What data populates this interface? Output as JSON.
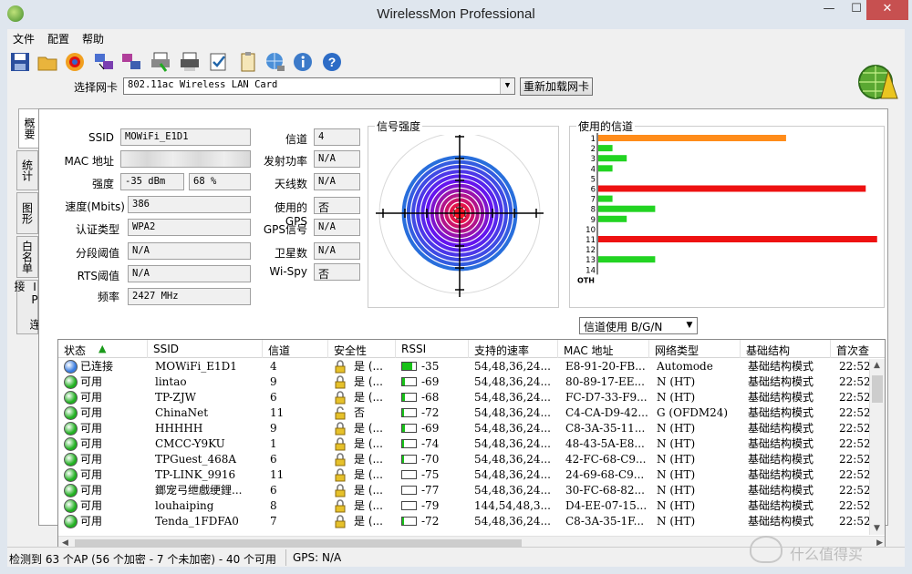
{
  "window": {
    "title": "WirelessMon Professional",
    "minimize": "—",
    "maximize": "☐",
    "close": "✕"
  },
  "menu": [
    "文件",
    "配置",
    "帮助"
  ],
  "toolbar": [
    "save-icon",
    "open-folder-icon",
    "record-icon",
    "network-monitor-icon",
    "network-compare-icon",
    "print-icon",
    "print-preview-icon",
    "check-list-icon",
    "clipboard-icon",
    "globe-connect-icon",
    "info-icon",
    "help-icon"
  ],
  "adapter": {
    "label": "选择网卡",
    "value": "802.11ac Wireless LAN Card",
    "reload": "重新加载网卡"
  },
  "tabs": [
    "概要",
    "统计",
    "图形",
    "白名单",
    "IP 连接"
  ],
  "summary": {
    "ssid_label": "SSID",
    "ssid": "MOWiFi_E1D1",
    "mac_label": "MAC 地址",
    "mac": "",
    "strength_label": "强度",
    "strength_dbm": "-35 dBm",
    "strength_pct": "68 %",
    "speed_label": "速度(Mbits)",
    "speed": "386",
    "auth_label": "认证类型",
    "auth": "WPA2",
    "frag_label": "分段阈值",
    "frag": "N/A",
    "rts_label": "RTS阈值",
    "rts": "N/A",
    "freq_label": "频率",
    "freq": "2427 MHz",
    "channel_label": "信道",
    "channel": "4",
    "txpower_label": "发射功率",
    "txpower": "N/A",
    "antenna_label": "天线数",
    "antenna": "N/A",
    "gps_used_label": "使用的GPS",
    "gps_used": "否",
    "gps_signal_label": "GPS信号",
    "gps_signal": "N/A",
    "satellites_label": "卫星数",
    "satellites": "N/A",
    "wispy_label": "Wi-Spy",
    "wispy": "否"
  },
  "signal_panel": {
    "title": "信号强度"
  },
  "chart_data": {
    "type": "bar",
    "title": "使用的信道",
    "categories": [
      "1",
      "2",
      "3",
      "4",
      "5",
      "6",
      "7",
      "8",
      "9",
      "10",
      "11",
      "12",
      "13",
      "14",
      "OTH"
    ],
    "values": [
      0.66,
      0.05,
      0.1,
      0.05,
      0,
      0.94,
      0.05,
      0.2,
      0.1,
      0,
      0.98,
      0,
      0.2,
      0,
      0
    ],
    "colors": [
      "#ff8c1a",
      "#22d422",
      "#22d422",
      "#22d422",
      "#22d422",
      "#ee1111",
      "#22d422",
      "#22d422",
      "#22d422",
      "#22d422",
      "#ee1111",
      "#22d422",
      "#22d422",
      "#22d422",
      "#22d422"
    ],
    "orientation": "horizontal"
  },
  "channel_filter": {
    "oth": "OTH",
    "value": "信道使用 B/G/N"
  },
  "table": {
    "columns": [
      "状态",
      "SSID",
      "信道",
      "安全性",
      "RSSI",
      "支持的速率",
      "MAC 地址",
      "网络类型",
      "基础结构",
      "首次查"
    ],
    "rows": [
      {
        "status": "已连接",
        "status_color": "#3a7de0",
        "ssid": "MOWiFi_E1D1",
        "channel": "4",
        "secure": "是 (...",
        "locked": true,
        "rssi": "-35",
        "rssi_pct": 0.7,
        "rates": "54,48,36,24...",
        "mac": "E8-91-20-FB...",
        "type": "Automode",
        "infra": "基础结构模式",
        "first": "22:52:"
      },
      {
        "status": "可用",
        "status_color": "#22b022",
        "ssid": "lintao",
        "channel": "9",
        "secure": "是 (...",
        "locked": true,
        "rssi": "-69",
        "rssi_pct": 0.2,
        "rates": "54,48,36,24...",
        "mac": "80-89-17-EE...",
        "type": "N (HT)",
        "infra": "基础结构模式",
        "first": "22:52:"
      },
      {
        "status": "可用",
        "status_color": "#22b022",
        "ssid": "TP-ZJW",
        "channel": "6",
        "secure": "是 (...",
        "locked": true,
        "rssi": "-68",
        "rssi_pct": 0.2,
        "rates": "54,48,36,24...",
        "mac": "FC-D7-33-F9...",
        "type": "N (HT)",
        "infra": "基础结构模式",
        "first": "22:52:"
      },
      {
        "status": "可用",
        "status_color": "#22b022",
        "ssid": "ChinaNet",
        "channel": "11",
        "secure": "否",
        "locked": false,
        "rssi": "-72",
        "rssi_pct": 0.15,
        "rates": "54,48,36,24...",
        "mac": "C4-CA-D9-42...",
        "type": "G (OFDM24)",
        "infra": "基础结构模式",
        "first": "22:52:"
      },
      {
        "status": "可用",
        "status_color": "#22b022",
        "ssid": "HHHHH",
        "channel": "9",
        "secure": "是 (...",
        "locked": true,
        "rssi": "-69",
        "rssi_pct": 0.2,
        "rates": "54,48,36,24...",
        "mac": "C8-3A-35-11...",
        "type": "N (HT)",
        "infra": "基础结构模式",
        "first": "22:52:"
      },
      {
        "status": "可用",
        "status_color": "#22b022",
        "ssid": "CMCC-Y9KU",
        "channel": "1",
        "secure": "是 (...",
        "locked": true,
        "rssi": "-74",
        "rssi_pct": 0.12,
        "rates": "54,48,36,24...",
        "mac": "48-43-5A-E8...",
        "type": "N (HT)",
        "infra": "基础结构模式",
        "first": "22:52:"
      },
      {
        "status": "可用",
        "status_color": "#22b022",
        "ssid": "TPGuest_468A",
        "channel": "6",
        "secure": "是 (...",
        "locked": true,
        "rssi": "-70",
        "rssi_pct": 0.15,
        "rates": "54,48,36,24...",
        "mac": "42-FC-68-C9...",
        "type": "N (HT)",
        "infra": "基础结构模式",
        "first": "22:52:"
      },
      {
        "status": "可用",
        "status_color": "#22b022",
        "ssid": "TP-LINK_9916",
        "channel": "11",
        "secure": "是 (...",
        "locked": true,
        "rssi": "-75",
        "rssi_pct": 0.0,
        "rates": "54,48,36,24...",
        "mac": "24-69-68-C9...",
        "type": "N (HT)",
        "infra": "基础结构模式",
        "first": "22:52:"
      },
      {
        "status": "可用",
        "status_color": "#22b022",
        "ssid": "鎯宠弓绁戲绠鋰...",
        "channel": "6",
        "secure": "是 (...",
        "locked": true,
        "rssi": "-77",
        "rssi_pct": 0.0,
        "rates": "54,48,36,24...",
        "mac": "30-FC-68-82...",
        "type": "N (HT)",
        "infra": "基础结构模式",
        "first": "22:52:"
      },
      {
        "status": "可用",
        "status_color": "#22b022",
        "ssid": "louhaiping",
        "channel": "8",
        "secure": "是 (...",
        "locked": true,
        "rssi": "-79",
        "rssi_pct": 0.0,
        "rates": "144,54,48,3...",
        "mac": "D4-EE-07-15...",
        "type": "N (HT)",
        "infra": "基础结构模式",
        "first": "22:52:"
      },
      {
        "status": "可用",
        "status_color": "#22b022",
        "ssid": "Tenda_1FDFA0",
        "channel": "7",
        "secure": "是 (...",
        "locked": true,
        "rssi": "-72",
        "rssi_pct": 0.15,
        "rates": "54,48,36,24...",
        "mac": "C8-3A-35-1F...",
        "type": "N (HT)",
        "infra": "基础结构模式",
        "first": "22:52:"
      }
    ]
  },
  "status": {
    "ap_count": "检测到 63 个AP (56 个加密 - 7 个未加密) - 40 个可用",
    "gps": "GPS: N/A"
  },
  "watermark": "什么值得买"
}
